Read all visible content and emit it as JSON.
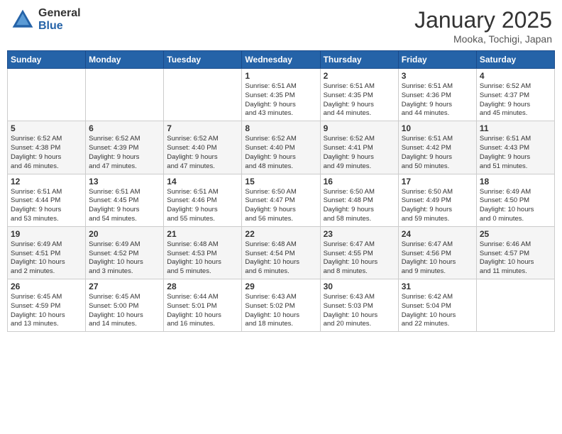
{
  "header": {
    "logo_general": "General",
    "logo_blue": "Blue",
    "month_title": "January 2025",
    "location": "Mooka, Tochigi, Japan"
  },
  "weekdays": [
    "Sunday",
    "Monday",
    "Tuesday",
    "Wednesday",
    "Thursday",
    "Friday",
    "Saturday"
  ],
  "weeks": [
    [
      {
        "day": "",
        "info": ""
      },
      {
        "day": "",
        "info": ""
      },
      {
        "day": "",
        "info": ""
      },
      {
        "day": "1",
        "info": "Sunrise: 6:51 AM\nSunset: 4:35 PM\nDaylight: 9 hours\nand 43 minutes."
      },
      {
        "day": "2",
        "info": "Sunrise: 6:51 AM\nSunset: 4:35 PM\nDaylight: 9 hours\nand 44 minutes."
      },
      {
        "day": "3",
        "info": "Sunrise: 6:51 AM\nSunset: 4:36 PM\nDaylight: 9 hours\nand 44 minutes."
      },
      {
        "day": "4",
        "info": "Sunrise: 6:52 AM\nSunset: 4:37 PM\nDaylight: 9 hours\nand 45 minutes."
      }
    ],
    [
      {
        "day": "5",
        "info": "Sunrise: 6:52 AM\nSunset: 4:38 PM\nDaylight: 9 hours\nand 46 minutes."
      },
      {
        "day": "6",
        "info": "Sunrise: 6:52 AM\nSunset: 4:39 PM\nDaylight: 9 hours\nand 47 minutes."
      },
      {
        "day": "7",
        "info": "Sunrise: 6:52 AM\nSunset: 4:40 PM\nDaylight: 9 hours\nand 47 minutes."
      },
      {
        "day": "8",
        "info": "Sunrise: 6:52 AM\nSunset: 4:40 PM\nDaylight: 9 hours\nand 48 minutes."
      },
      {
        "day": "9",
        "info": "Sunrise: 6:52 AM\nSunset: 4:41 PM\nDaylight: 9 hours\nand 49 minutes."
      },
      {
        "day": "10",
        "info": "Sunrise: 6:51 AM\nSunset: 4:42 PM\nDaylight: 9 hours\nand 50 minutes."
      },
      {
        "day": "11",
        "info": "Sunrise: 6:51 AM\nSunset: 4:43 PM\nDaylight: 9 hours\nand 51 minutes."
      }
    ],
    [
      {
        "day": "12",
        "info": "Sunrise: 6:51 AM\nSunset: 4:44 PM\nDaylight: 9 hours\nand 53 minutes."
      },
      {
        "day": "13",
        "info": "Sunrise: 6:51 AM\nSunset: 4:45 PM\nDaylight: 9 hours\nand 54 minutes."
      },
      {
        "day": "14",
        "info": "Sunrise: 6:51 AM\nSunset: 4:46 PM\nDaylight: 9 hours\nand 55 minutes."
      },
      {
        "day": "15",
        "info": "Sunrise: 6:50 AM\nSunset: 4:47 PM\nDaylight: 9 hours\nand 56 minutes."
      },
      {
        "day": "16",
        "info": "Sunrise: 6:50 AM\nSunset: 4:48 PM\nDaylight: 9 hours\nand 58 minutes."
      },
      {
        "day": "17",
        "info": "Sunrise: 6:50 AM\nSunset: 4:49 PM\nDaylight: 9 hours\nand 59 minutes."
      },
      {
        "day": "18",
        "info": "Sunrise: 6:49 AM\nSunset: 4:50 PM\nDaylight: 10 hours\nand 0 minutes."
      }
    ],
    [
      {
        "day": "19",
        "info": "Sunrise: 6:49 AM\nSunset: 4:51 PM\nDaylight: 10 hours\nand 2 minutes."
      },
      {
        "day": "20",
        "info": "Sunrise: 6:49 AM\nSunset: 4:52 PM\nDaylight: 10 hours\nand 3 minutes."
      },
      {
        "day": "21",
        "info": "Sunrise: 6:48 AM\nSunset: 4:53 PM\nDaylight: 10 hours\nand 5 minutes."
      },
      {
        "day": "22",
        "info": "Sunrise: 6:48 AM\nSunset: 4:54 PM\nDaylight: 10 hours\nand 6 minutes."
      },
      {
        "day": "23",
        "info": "Sunrise: 6:47 AM\nSunset: 4:55 PM\nDaylight: 10 hours\nand 8 minutes."
      },
      {
        "day": "24",
        "info": "Sunrise: 6:47 AM\nSunset: 4:56 PM\nDaylight: 10 hours\nand 9 minutes."
      },
      {
        "day": "25",
        "info": "Sunrise: 6:46 AM\nSunset: 4:57 PM\nDaylight: 10 hours\nand 11 minutes."
      }
    ],
    [
      {
        "day": "26",
        "info": "Sunrise: 6:45 AM\nSunset: 4:59 PM\nDaylight: 10 hours\nand 13 minutes."
      },
      {
        "day": "27",
        "info": "Sunrise: 6:45 AM\nSunset: 5:00 PM\nDaylight: 10 hours\nand 14 minutes."
      },
      {
        "day": "28",
        "info": "Sunrise: 6:44 AM\nSunset: 5:01 PM\nDaylight: 10 hours\nand 16 minutes."
      },
      {
        "day": "29",
        "info": "Sunrise: 6:43 AM\nSunset: 5:02 PM\nDaylight: 10 hours\nand 18 minutes."
      },
      {
        "day": "30",
        "info": "Sunrise: 6:43 AM\nSunset: 5:03 PM\nDaylight: 10 hours\nand 20 minutes."
      },
      {
        "day": "31",
        "info": "Sunrise: 6:42 AM\nSunset: 5:04 PM\nDaylight: 10 hours\nand 22 minutes."
      },
      {
        "day": "",
        "info": ""
      }
    ]
  ]
}
